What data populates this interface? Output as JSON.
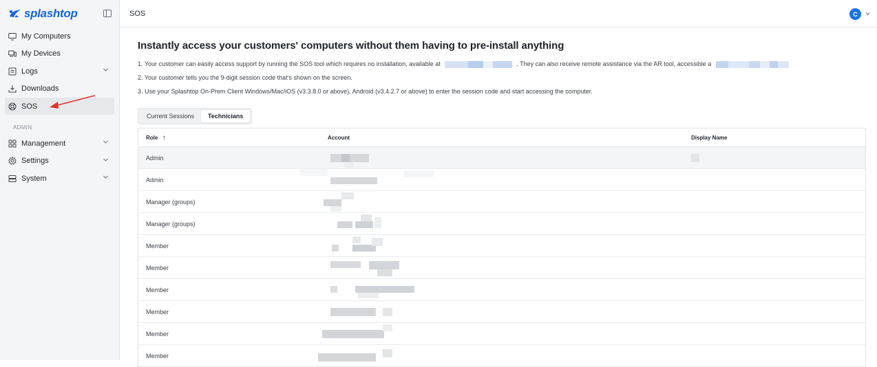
{
  "app": {
    "brand": "splashtop"
  },
  "sidebar": {
    "items": [
      {
        "label": "My Computers",
        "icon": "monitor-icon"
      },
      {
        "label": "My Devices",
        "icon": "devices-icon"
      },
      {
        "label": "Logs",
        "icon": "logs-icon"
      },
      {
        "label": "Downloads",
        "icon": "download-icon"
      },
      {
        "label": "SOS",
        "icon": "sos-icon"
      }
    ],
    "admin_label": "ADMIN",
    "admin_items": [
      {
        "label": "Management",
        "icon": "grid-icon"
      },
      {
        "label": "Settings",
        "icon": "gear-icon"
      },
      {
        "label": "System",
        "icon": "server-icon"
      }
    ]
  },
  "header": {
    "title": "SOS",
    "avatar_initial": "C"
  },
  "main": {
    "heading": "Instantly access your customers' computers without them having to pre-install anything",
    "step1_a": "1. Your customer can easily access support by running the SOS tool which requires no installation, available at",
    "step1_b": ". They can also receive remote assistance via the AR tool, accessible a",
    "step2": "2. Your customer tells you the 9-digit session code that's shown on the screen.",
    "step3": "3. Use your Splashtop On-Prem Client Windows/Mac/iOS (v3.3.8.0 or above), Android (v3.4.2.7 or above) to enter the session code and start accessing the computer.",
    "tabs": [
      "Current Sessions",
      "Technicians"
    ],
    "table": {
      "columns": [
        "Role",
        "Account",
        "Display Name"
      ],
      "sort_indicator": "↑",
      "rows": [
        {
          "role": "Admin"
        },
        {
          "role": "Admin"
        },
        {
          "role": "Manager (groups)"
        },
        {
          "role": "Manager (groups)"
        },
        {
          "role": "Member"
        },
        {
          "role": "Member"
        },
        {
          "role": "Member"
        },
        {
          "role": "Member"
        },
        {
          "role": "Member"
        },
        {
          "role": "Member"
        }
      ]
    }
  },
  "colors": {
    "accent": "#1a73e8",
    "arrow": "#e5322d",
    "sidebar_bg": "#f4f5f7"
  }
}
